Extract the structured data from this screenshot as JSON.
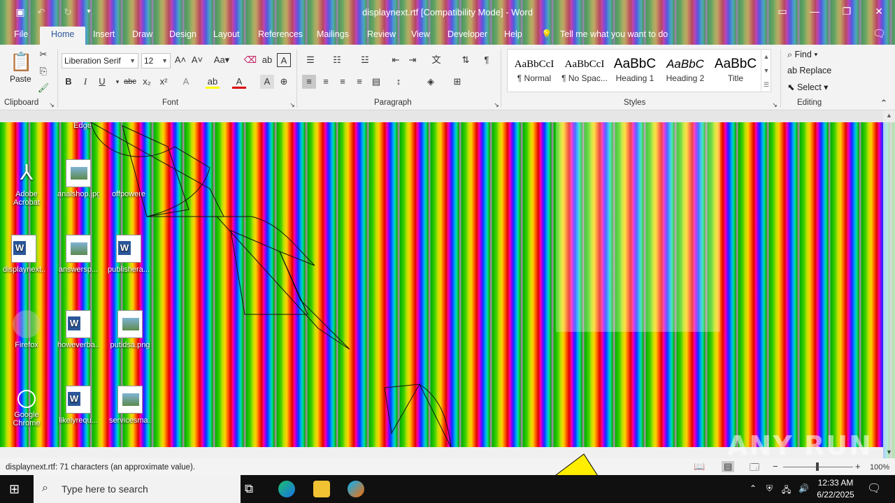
{
  "window": {
    "title": "displaynext.rtf [Compatibility Mode]  -  Word"
  },
  "tabs": [
    {
      "label": "File"
    },
    {
      "label": "Home"
    },
    {
      "label": "Insert"
    },
    {
      "label": "Draw"
    },
    {
      "label": "Design"
    },
    {
      "label": "Layout"
    },
    {
      "label": "References"
    },
    {
      "label": "Mailings"
    },
    {
      "label": "Review"
    },
    {
      "label": "View"
    },
    {
      "label": "Developer"
    },
    {
      "label": "Help"
    }
  ],
  "tell_me": "Tell me what you want to do",
  "clipboard": {
    "paste_label": "Paste",
    "group_label": "Clipboard"
  },
  "font": {
    "name": "Liberation Serif",
    "size": "12",
    "group_label": "Font"
  },
  "paragraph": {
    "group_label": "Paragraph"
  },
  "styles": {
    "group_label": "Styles",
    "items": [
      {
        "preview": "AaBbCcI",
        "name": "¶ Normal"
      },
      {
        "preview": "AaBbCcI",
        "name": "¶ No Spac..."
      },
      {
        "preview": "AaBbC",
        "name": "Heading 1"
      },
      {
        "preview": "AaBbC",
        "name": "Heading 2"
      },
      {
        "preview": "AaBbC",
        "name": "Title"
      }
    ]
  },
  "editing": {
    "group_label": "Editing",
    "find": "Find",
    "replace": "Replace",
    "select": "Select"
  },
  "status": {
    "message": "displaynext.rtf: 71 characters (an approximate value).",
    "zoom": "100%"
  },
  "desktop_icons": [
    {
      "label": "Adobe Acrobat"
    },
    {
      "label": "analshop.jpg"
    },
    {
      "label": "offpowere"
    },
    {
      "label": "displaynext..."
    },
    {
      "label": "answersp..."
    },
    {
      "label": "publishera..."
    },
    {
      "label": "Firefox"
    },
    {
      "label": "howeverba..."
    },
    {
      "label": "putidsa.png"
    },
    {
      "label": "Google Chrome"
    },
    {
      "label": "likelyrequ..."
    },
    {
      "label": "servicesma..."
    },
    {
      "label": "Edge"
    }
  ],
  "taskbar": {
    "search_placeholder": "Type here to search",
    "time": "12:33 AM",
    "date": "6/22/2025"
  },
  "watermark": "ANY RUN"
}
